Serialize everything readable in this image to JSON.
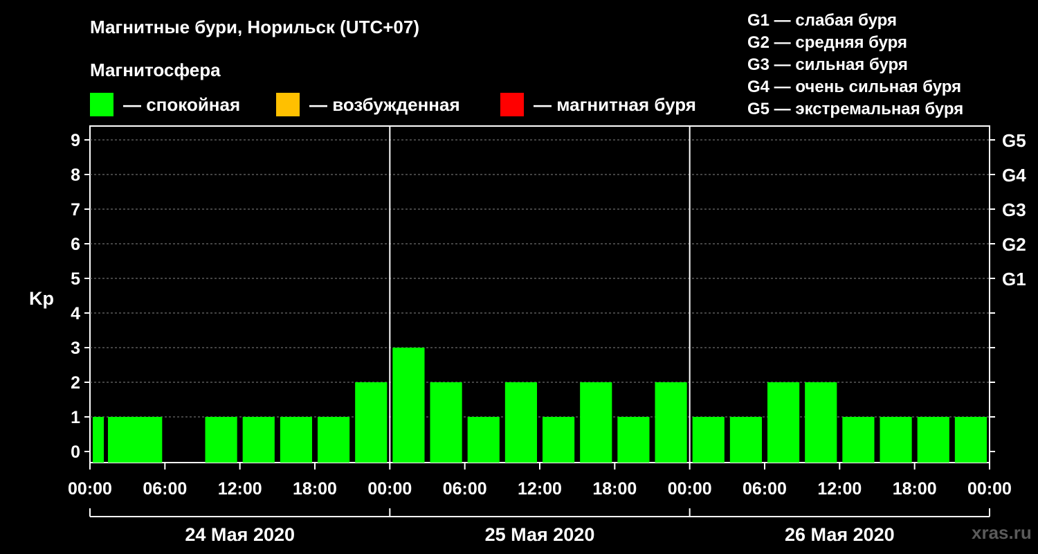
{
  "title": "Магнитные бури, Норильск (UTC+07)",
  "subtitle": "Магнитосфера",
  "legend": [
    {
      "label": "— спокойная",
      "color": "#00ff00"
    },
    {
      "label": "— возбужденная",
      "color": "#ffc000"
    },
    {
      "label": "— магнитная буря",
      "color": "#ff0000"
    }
  ],
  "storm_levels": [
    "G1 — слабая буря",
    "G2 — средняя буря",
    "G3 — сильная буря",
    "G4 — очень сильная буря",
    "G5 — экстремальная буря"
  ],
  "watermark": "xras.ru",
  "chart_data": {
    "type": "bar",
    "title": "Магнитные бури, Норильск (UTC+07)",
    "ylabel": "Kp",
    "ylim": [
      0,
      9
    ],
    "yticks": [
      0,
      1,
      2,
      3,
      4,
      5,
      6,
      7,
      8,
      9
    ],
    "right_ticks": [
      {
        "value": 5,
        "label": "G1"
      },
      {
        "value": 6,
        "label": "G2"
      },
      {
        "value": 7,
        "label": "G3"
      },
      {
        "value": 8,
        "label": "G4"
      },
      {
        "value": 9,
        "label": "G5"
      }
    ],
    "x_tick_labels": [
      "00:00",
      "06:00",
      "12:00",
      "18:00",
      "00:00",
      "06:00",
      "12:00",
      "18:00",
      "00:00",
      "06:00",
      "12:00",
      "18:00",
      "00:00"
    ],
    "days": [
      "24 Мая 2020",
      "25 Мая 2020",
      "26 Мая 2020"
    ],
    "bar_color": "#00ff00",
    "grid": "dashed horizontal",
    "categories": [
      "24 Мая 2020 00:00",
      "24 Мая 2020 03:00",
      "24 Мая 2020 06:00",
      "24 Мая 2020 09:00",
      "24 Мая 2020 12:00",
      "24 Мая 2020 15:00",
      "24 Мая 2020 18:00",
      "24 Мая 2020 21:00",
      "25 Мая 2020 00:00",
      "25 Мая 2020 03:00",
      "25 Мая 2020 06:00",
      "25 Мая 2020 09:00",
      "25 Мая 2020 12:00",
      "25 Мая 2020 15:00",
      "25 Мая 2020 18:00",
      "25 Мая 2020 21:00",
      "26 Мая 2020 00:00",
      "26 Мая 2020 03:00",
      "26 Мая 2020 06:00",
      "26 Мая 2020 09:00",
      "26 Мая 2020 12:00",
      "26 Мая 2020 15:00",
      "26 Мая 2020 18:00",
      "26 Мая 2020 21:00"
    ],
    "values": [
      1,
      1,
      0,
      1,
      1,
      1,
      1,
      2,
      3,
      2,
      1,
      2,
      1,
      2,
      1,
      2,
      1,
      1,
      2,
      2,
      1,
      1,
      1,
      1
    ]
  }
}
